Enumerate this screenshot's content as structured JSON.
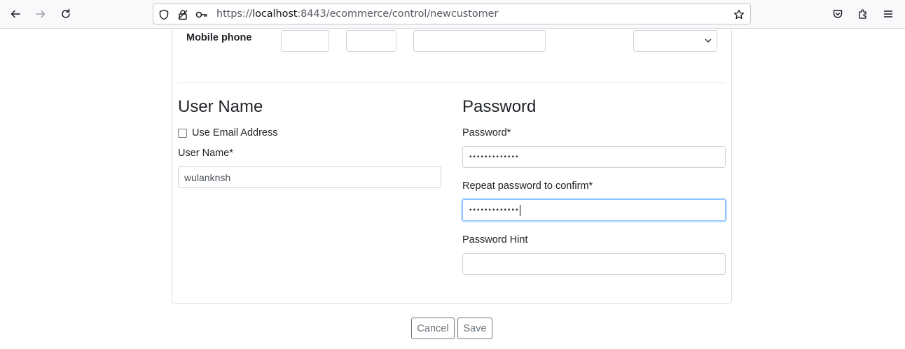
{
  "browser": {
    "url_prefix": "https://",
    "url_host": "localhost",
    "url_rest": ":8443/ecommerce/control/newcustomer",
    "icons": [
      "back-icon",
      "forward-icon",
      "reload-icon",
      "shield-icon",
      "lock-icon",
      "key-icon",
      "star-icon",
      "pocket-icon",
      "extensions-icon",
      "menu-icon"
    ]
  },
  "phone": {
    "label": "Mobile phone"
  },
  "username_section": {
    "title": "User Name",
    "use_email_label": "Use Email Address",
    "use_email_checked": false,
    "username_label": "User Name*",
    "username_value": "wulanknsh"
  },
  "password_section": {
    "title": "Password",
    "password_label": "Password*",
    "password_value": "•••••••••••••",
    "confirm_label": "Repeat password to confirm*",
    "confirm_value": "•••••••••••••",
    "hint_label": "Password Hint",
    "hint_value": ""
  },
  "actions": {
    "cancel_label": "Cancel",
    "save_label": "Save"
  },
  "colors": {
    "focus_border": "#80bdff",
    "button_border": "#6c757d",
    "input_border": "#ced4da"
  }
}
